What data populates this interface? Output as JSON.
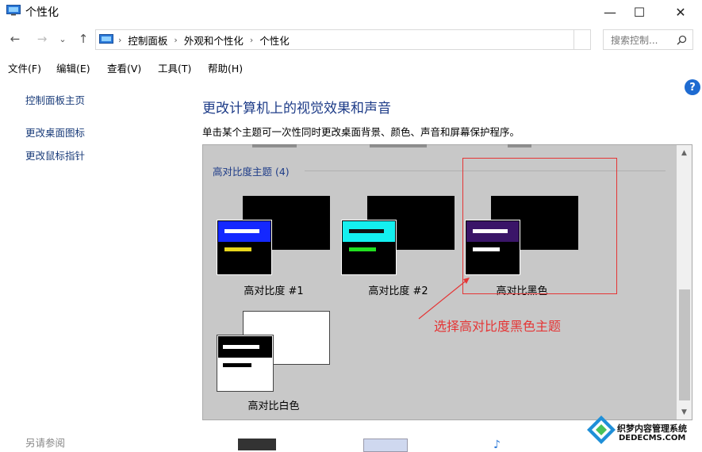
{
  "window": {
    "title": "个性化",
    "minimize": "—",
    "maximize": "☐",
    "close": "✕"
  },
  "nav": {
    "back": "←",
    "forward": "→",
    "recent": "⌄",
    "up": "↑"
  },
  "address": {
    "crumbs": [
      "控制面板",
      "外观和个性化",
      "个性化"
    ],
    "separator": "›"
  },
  "search": {
    "placeholder": "搜索控制...",
    "icon": "search-icon"
  },
  "menu": [
    "文件(F)",
    "编辑(E)",
    "查看(V)",
    "工具(T)",
    "帮助(H)"
  ],
  "sidebar": {
    "links": [
      "控制面板主页",
      "更改桌面图标",
      "更改鼠标指针"
    ],
    "see_also": "另请参阅"
  },
  "help": "?",
  "main": {
    "title": "更改计算机上的视觉效果和声音",
    "description": "单击某个主题可一次性同时更改桌面背景、颜色、声音和屏幕保护程序。"
  },
  "themes": {
    "group_label": "高对比度主题 (4)",
    "items": [
      {
        "name": "高对比度 #1",
        "header_color": "#1428ff",
        "bar1": "#ffffff",
        "bar2": "#e8d61c"
      },
      {
        "name": "高对比度 #2",
        "header_color": "#14f0f0",
        "bar1": "#111111",
        "bar2": "#20e020"
      },
      {
        "name": "高对比黑色",
        "header_color": "#3a1568",
        "bar1": "#ffffff",
        "bar2": "#ffffff"
      },
      {
        "name": "高对比白色",
        "header_color": "#000000",
        "bar1": "#ffffff",
        "bar2": "#000000"
      }
    ]
  },
  "annotation": {
    "text": "选择高对比度黑色主题",
    "color": "#e53535"
  },
  "watermark": {
    "text": "织梦内容管理系统",
    "url": "DEDECMS.COM"
  }
}
